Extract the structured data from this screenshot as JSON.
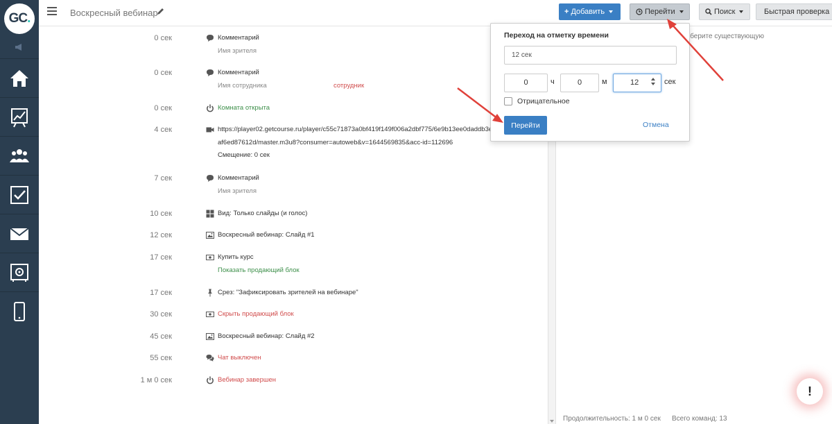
{
  "logo": {
    "text": "GC",
    "dot": "."
  },
  "header": {
    "title": "Воскресный вебинар",
    "add_label": "Добавить",
    "goto_label": "Перейти",
    "search_label": "Поиск",
    "quick_label": "Быстрая проверка"
  },
  "events": [
    {
      "time": "0 сек",
      "icon": "comment-icon",
      "line1": "Комментарий",
      "line2": "Имя зрителя"
    },
    {
      "time": "0 сек",
      "icon": "comment-icon",
      "line1": "Комментарий",
      "line2": "Имя сотрудника",
      "tag": "сотрудник"
    },
    {
      "time": "0 сек",
      "icon": "power-icon",
      "line1": "Комната открыта",
      "style": "green"
    },
    {
      "time": "4 сек",
      "icon": "video-icon",
      "line1": "https://player02.getcourse.ru/player/c55c71873a0bf419f149f006a2dbf775/6e9b13ee0daddb3e68",
      "line2": "af6ed87612d/master.m3u8?consumer=autoweb&v=1644569835&acc-id=112696",
      "line3": "Смещение: 0 сек"
    },
    {
      "time": "7 сек",
      "icon": "comment-icon",
      "line1": "Комментарий",
      "line2": "Имя зрителя"
    },
    {
      "time": "10 сек",
      "icon": "grid-icon",
      "line1": "Вид: Только слайды (и голос)"
    },
    {
      "time": "12 сек",
      "icon": "image-icon",
      "line1": "Воскресный вебинар: Слайд #1"
    },
    {
      "time": "17 сек",
      "icon": "money-icon",
      "line1": "Купить курс",
      "line2": "Показать продающий блок",
      "line2style": "green"
    },
    {
      "time": "17 сек",
      "icon": "pin-icon",
      "line1": "Срез: \"Зафиксировать зрителей на вебинаре\""
    },
    {
      "time": "30 сек",
      "icon": "money-icon",
      "line1": "Скрыть продающий блок",
      "style": "red"
    },
    {
      "time": "45 сек",
      "icon": "image-icon",
      "line1": "Воскресный вебинар: Слайд #2"
    },
    {
      "time": "55 сек",
      "icon": "comments-icon",
      "line1": "Чат выключен",
      "style": "red"
    },
    {
      "time": "1 м 0 сек",
      "icon": "power-icon",
      "line1": "Вебинар завершен",
      "style": "red"
    }
  ],
  "right_panel": {
    "hint": "ыберите существующую",
    "duration": "Продолжительность: 1 м 0 сек",
    "total": "Всего команд: 13"
  },
  "goto_popup": {
    "title": "Переход на отметку времени",
    "input_value": "12 сек",
    "hours": "0",
    "hours_unit": "ч",
    "minutes": "0",
    "minutes_unit": "м",
    "seconds": "12",
    "seconds_unit": "сек",
    "negative_label": "Отрицательное",
    "go_label": "Перейти",
    "cancel_label": "Отмена"
  },
  "help": {
    "label": "!"
  },
  "colors": {
    "sidebar": "#2b3e50",
    "primary": "#3a7fc4",
    "green": "#3d8f4a",
    "red": "#d04b4b",
    "arrow": "#e0413a"
  }
}
